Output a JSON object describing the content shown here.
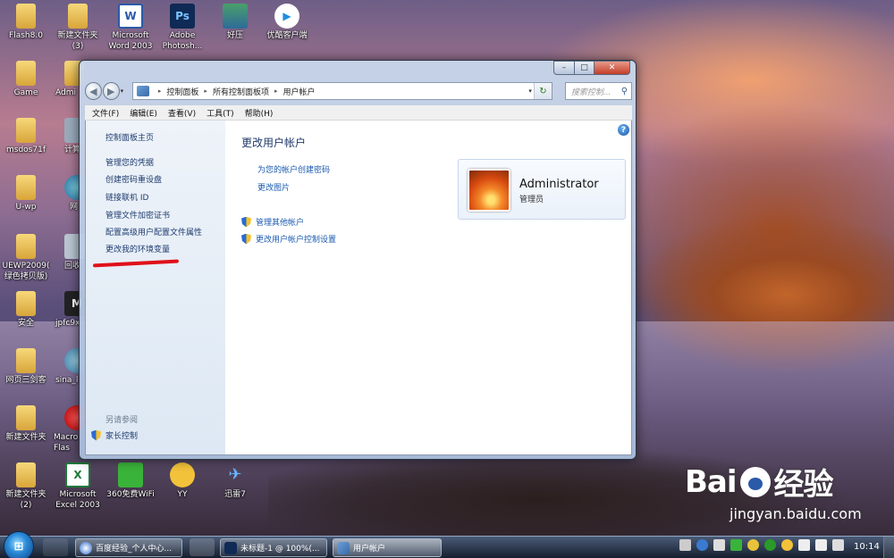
{
  "desktop": {
    "icons": [
      {
        "label": "Flash8.0",
        "glyph": "folder-icon"
      },
      {
        "label": "新建文件夹\n(3)",
        "glyph": "folder-icon"
      },
      {
        "label": "Microsoft\nWord 2003",
        "glyph": "W"
      },
      {
        "label": "Adobe\nPhotosh...",
        "glyph": "Ps"
      },
      {
        "label": "好压",
        "glyph": "haoya-icon"
      },
      {
        "label": "优酷客户端",
        "glyph": "▶"
      },
      {
        "label": "Game",
        "glyph": "folder-icon"
      },
      {
        "label": "Admi",
        "glyph": "folder-icon"
      },
      {
        "label": "msdos71f",
        "glyph": "folder-icon"
      },
      {
        "label": "计算",
        "glyph": "computer-icon"
      },
      {
        "label": "U-wp",
        "glyph": "folder-icon"
      },
      {
        "label": "网",
        "glyph": "network-icon"
      },
      {
        "label": "UEWP2009(\n绿色拷贝版)",
        "glyph": "folder-icon"
      },
      {
        "label": "回收",
        "glyph": "recycle-icon"
      },
      {
        "label": "安全",
        "glyph": "folder-icon"
      },
      {
        "label": "jpfc9x",
        "glyph": "M"
      },
      {
        "label": "网页三剑客",
        "glyph": "folder-icon"
      },
      {
        "label": "sina_l",
        "glyph": "globe-icon"
      },
      {
        "label": "新建文件夹",
        "glyph": "folder-icon"
      },
      {
        "label": "Macro\nFlas",
        "glyph": "flash-icon"
      },
      {
        "label": "新建文件夹\n(2)",
        "glyph": "folder-icon"
      },
      {
        "label": "Microsoft\nExcel 2003",
        "glyph": "X"
      },
      {
        "label": "360免费WiFi",
        "glyph": "wifi-icon"
      },
      {
        "label": "YY",
        "glyph": "yy-icon"
      },
      {
        "label": "迅雷7",
        "glyph": "✈"
      }
    ]
  },
  "window": {
    "caption": {
      "min": "–",
      "max": "□",
      "close": "✕"
    },
    "nav": {
      "back": "◀",
      "forward": "▶",
      "dropdown": "▾"
    },
    "breadcrumb": [
      "控制面板",
      "所有控制面板项",
      "用户帐户"
    ],
    "breadcrumb_sep": "▸",
    "address_drop": "▾",
    "refresh": "↻",
    "search_placeholder": "搜索控制...",
    "search_icon": "⚲",
    "menu": [
      "文件(F)",
      "编辑(E)",
      "查看(V)",
      "工具(T)",
      "帮助(H)"
    ],
    "help": "?",
    "left": {
      "home": "控制面板主页",
      "links": [
        "管理您的凭据",
        "创建密码重设盘",
        "链接联机 ID",
        "管理文件加密证书",
        "配置高级用户配置文件属性",
        "更改我的环境变量"
      ],
      "see_also": "另请参阅",
      "family": "家长控制"
    },
    "main": {
      "title": "更改用户帐户",
      "links": [
        "为您的帐户创建密码",
        "更改图片"
      ],
      "shield_links": [
        "管理其他帐户",
        "更改用户帐户控制设置"
      ]
    },
    "user": {
      "name": "Administrator",
      "role": "管理员"
    }
  },
  "taskbar": {
    "start": "⊞",
    "tasks": [
      {
        "label": "百度经验_个人中心..."
      },
      {
        "label": "未标题-1 @ 100%(..."
      },
      {
        "label": "用户帐户"
      }
    ],
    "clock": "10:14"
  },
  "watermark": {
    "logo_left": "Bai",
    "logo_right": "经验",
    "url": "jingyan.baidu.com"
  },
  "colors": {
    "link": "#1b5ab0",
    "title": "#1e3a6a",
    "annotation": "#e0101a"
  }
}
